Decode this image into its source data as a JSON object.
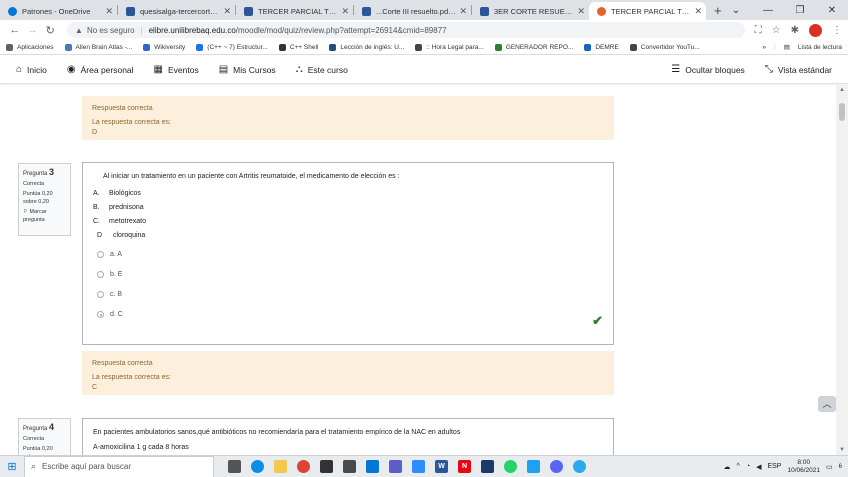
{
  "browser": {
    "tabs": [
      {
        "title": "Patrones - OneDrive",
        "icon": "onedrive-icon",
        "color": "#0078d4",
        "active": false
      },
      {
        "title": "quesisalga-tercercorte (1).p...",
        "icon": "word-icon",
        "color": "#2b579a",
        "active": false
      },
      {
        "title": "TERCER PARCIAL TEÓRICO...",
        "icon": "word-icon",
        "color": "#2b579a",
        "active": false
      },
      {
        "title": "...Corte III resuelto.pdf - Mic...",
        "icon": "word-icon",
        "color": "#2b579a",
        "active": false
      },
      {
        "title": "3ER CORTE RESUELTOU.pdf...",
        "icon": "word-icon",
        "color": "#2b579a",
        "active": false
      },
      {
        "title": "TERCER PARCIAL TEÓRICO...",
        "icon": "moodle-icon",
        "color": "#e06628",
        "active": true
      }
    ],
    "new_tab": "+",
    "address": {
      "warning": "No es seguro",
      "host": "elibre.unilibrebaq.edu.co",
      "path": "/moodle/mod/quiz/review.php?attempt=26914&cmid=89877"
    },
    "bookmarks": [
      {
        "label": "Aplicaciones",
        "color": "#5f6368"
      },
      {
        "label": "Allen Brain Atlas -...",
        "color": "#4a7ab5"
      },
      {
        "label": "Wikiversity",
        "color": "#3366cc"
      },
      {
        "label": "(C++ ~ 7) Estructur...",
        "color": "#1a73e8"
      },
      {
        "label": "C++ Shell",
        "color": "#333333"
      },
      {
        "label": "Lección de inglés: U...",
        "color": "#1f4e79"
      },
      {
        "label": ":: Hora Legal para...",
        "color": "#444444"
      },
      {
        "label": "GENERADOR REPO...",
        "color": "#2e7d32"
      },
      {
        "label": "DEMRE",
        "color": "#1565c0"
      },
      {
        "label": "Convertidor YouTu...",
        "color": "#444444"
      }
    ],
    "reading_list": "Lista de lectura"
  },
  "moodle_nav": {
    "items": [
      {
        "label": "Inicio",
        "icon": "home-icon",
        "glyph": "⌂"
      },
      {
        "label": "Área personal",
        "icon": "dashboard-icon",
        "glyph": "◉"
      },
      {
        "label": "Eventos",
        "icon": "calendar-icon",
        "glyph": "▦"
      },
      {
        "label": "Mis Cursos",
        "icon": "courses-icon",
        "glyph": "▤"
      },
      {
        "label": "Este curso",
        "icon": "sitemap-icon",
        "glyph": "⛬"
      }
    ],
    "right": [
      {
        "label": "Ocultar bloques",
        "icon": "hide-blocks-icon",
        "glyph": "☰"
      },
      {
        "label": "Vista estándar",
        "icon": "expand-icon",
        "glyph": "⤡"
      }
    ]
  },
  "feedback_prev": {
    "title": "Respuesta correcta",
    "line": "La respuesta correcta es:",
    "answer": "D"
  },
  "question3": {
    "label": "Pregunta",
    "number": "3",
    "status": "Correcta",
    "score": "Puntúa 0,20 sobre 0,20",
    "flag": "Marcar pregunta",
    "text": "Al iniciar un tratamiento en un paciente con Artritis reumatoide, el medicamento de elección es :",
    "options": [
      {
        "letter": "A.",
        "text": "Biológicos"
      },
      {
        "letter": "B.",
        "text": "prednisona"
      },
      {
        "letter": "C.",
        "text": "metotrexato"
      },
      {
        "letter": "D",
        "text": "cloroquina"
      }
    ],
    "answers": [
      {
        "label": "a. A",
        "checked": false
      },
      {
        "label": "b. E",
        "checked": false
      },
      {
        "label": "c. B",
        "checked": false
      },
      {
        "label": "d. C",
        "checked": true
      }
    ]
  },
  "feedback3": {
    "title": "Respuesta correcta",
    "line": "La respuesta correcta es:",
    "answer": "C"
  },
  "question4": {
    "label": "Pregunta",
    "number": "4",
    "status": "Correcta",
    "score": "Puntúa 0,20 sobre",
    "text": "En pacientes ambulatorios sanos,qué antibióticos no recomiendaría    para el tratamiento empírico de la NAC en adultos",
    "option1": "A-amoxicilina 1 g cada 8 horas"
  },
  "taskbar": {
    "search_placeholder": "Escribe aquí para buscar",
    "lang": "ESP",
    "time": "8:00",
    "date": "10/06/2021",
    "notifications": "6"
  }
}
